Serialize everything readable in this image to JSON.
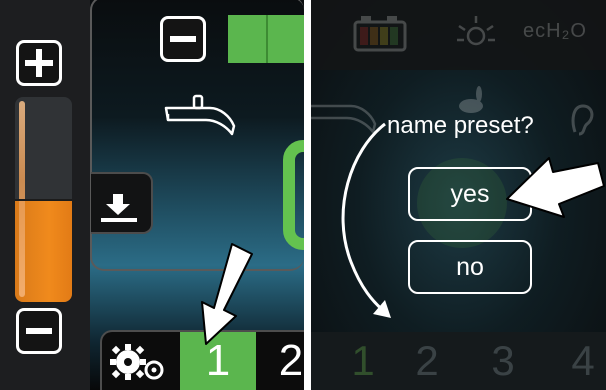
{
  "left_panel": {
    "plus_icon": "plus-icon",
    "minus_icon": "minus-icon",
    "level_meter": {
      "fill_fraction": 0.5,
      "fill_color": "#f08a1c"
    },
    "download_icon": "download-tray-icon",
    "settings_icon": "gears-icon",
    "tabs": [
      {
        "label": "1",
        "active": true
      },
      {
        "label": "2",
        "active": false
      }
    ],
    "accent_color": "#5bb64e",
    "pointer_arrow": "white-arrow"
  },
  "right_panel": {
    "status_icons": [
      "battery-icon",
      "light-icon"
    ],
    "status_text": "ecH₂O",
    "dialog": {
      "prompt": "name preset?",
      "yes_label": "yes",
      "no_label": "no"
    },
    "tabs": [
      {
        "label": "1"
      },
      {
        "label": "2"
      },
      {
        "label": "3"
      },
      {
        "label": "4"
      }
    ]
  }
}
